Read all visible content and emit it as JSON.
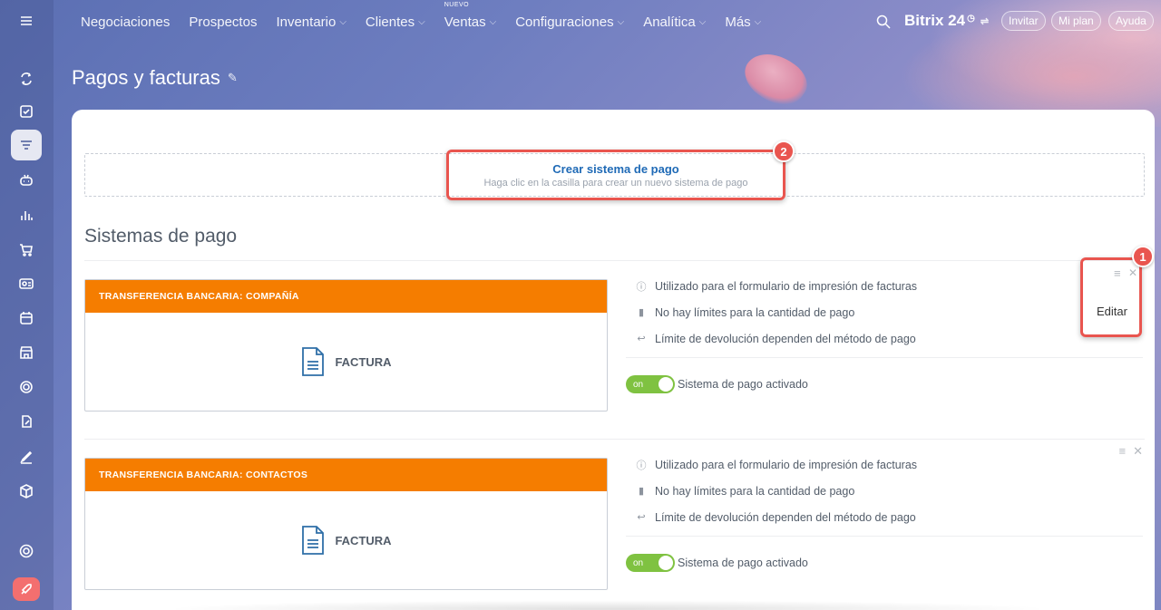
{
  "topnav": {
    "items": [
      {
        "label": "Negociaciones",
        "chevron": false
      },
      {
        "label": "Prospectos",
        "chevron": false
      },
      {
        "label": "Inventario",
        "chevron": true
      },
      {
        "label": "Clientes",
        "chevron": true
      },
      {
        "label": "Ventas",
        "chevron": true,
        "badge": "NUEVO"
      },
      {
        "label": "Configuraciones",
        "chevron": true
      },
      {
        "label": "Analítica",
        "chevron": true
      },
      {
        "label": "Más",
        "chevron": true
      }
    ],
    "brand": "Bitrix 24",
    "invite": "Invitar",
    "plan": "Mi plan",
    "help": "Ayuda"
  },
  "page": {
    "title": "Pagos y facturas"
  },
  "create": {
    "title": "Crear sistema de pago",
    "subtitle": "Haga clic en la casilla para crear un nuevo sistema de pago"
  },
  "section_title": "Sistemas de pago",
  "payment_systems": [
    {
      "header": "TRANSFERENCIA BANCARIA: COMPAÑÍA",
      "label": "FACTURA",
      "info": [
        "Utilizado para el formulario de impresión de facturas",
        "No hay límites para la cantidad de pago",
        "Límite de devolución dependen del método de pago"
      ],
      "toggle": "on",
      "status": "Sistema de pago activado"
    },
    {
      "header": "TRANSFERENCIA BANCARIA: CONTACTOS",
      "label": "FACTURA",
      "info": [
        "Utilizado para el formulario de impresión de facturas",
        "No hay límites para la cantidad de pago",
        "Límite de devolución dependen del método de pago"
      ],
      "toggle": "on",
      "status": "Sistema de pago activado"
    }
  ],
  "popup": {
    "edit": "Editar"
  },
  "annotations": {
    "one": "1",
    "two": "2"
  },
  "sidebar_icons": [
    "menu-icon",
    "sync-icon",
    "tasks-icon",
    "crm-funnel-icon",
    "robot-icon",
    "analytics-icon",
    "cart-icon",
    "contact-card-icon",
    "calendar-icon",
    "store-icon",
    "target-icon",
    "doc-edit-icon",
    "sign-icon",
    "box-icon",
    "settings-icon",
    "rocket-icon"
  ],
  "colors": {
    "accent": "#f57d00",
    "link": "#1f6ab6",
    "toggle": "#7fc241",
    "highlight": "#e9554f"
  }
}
